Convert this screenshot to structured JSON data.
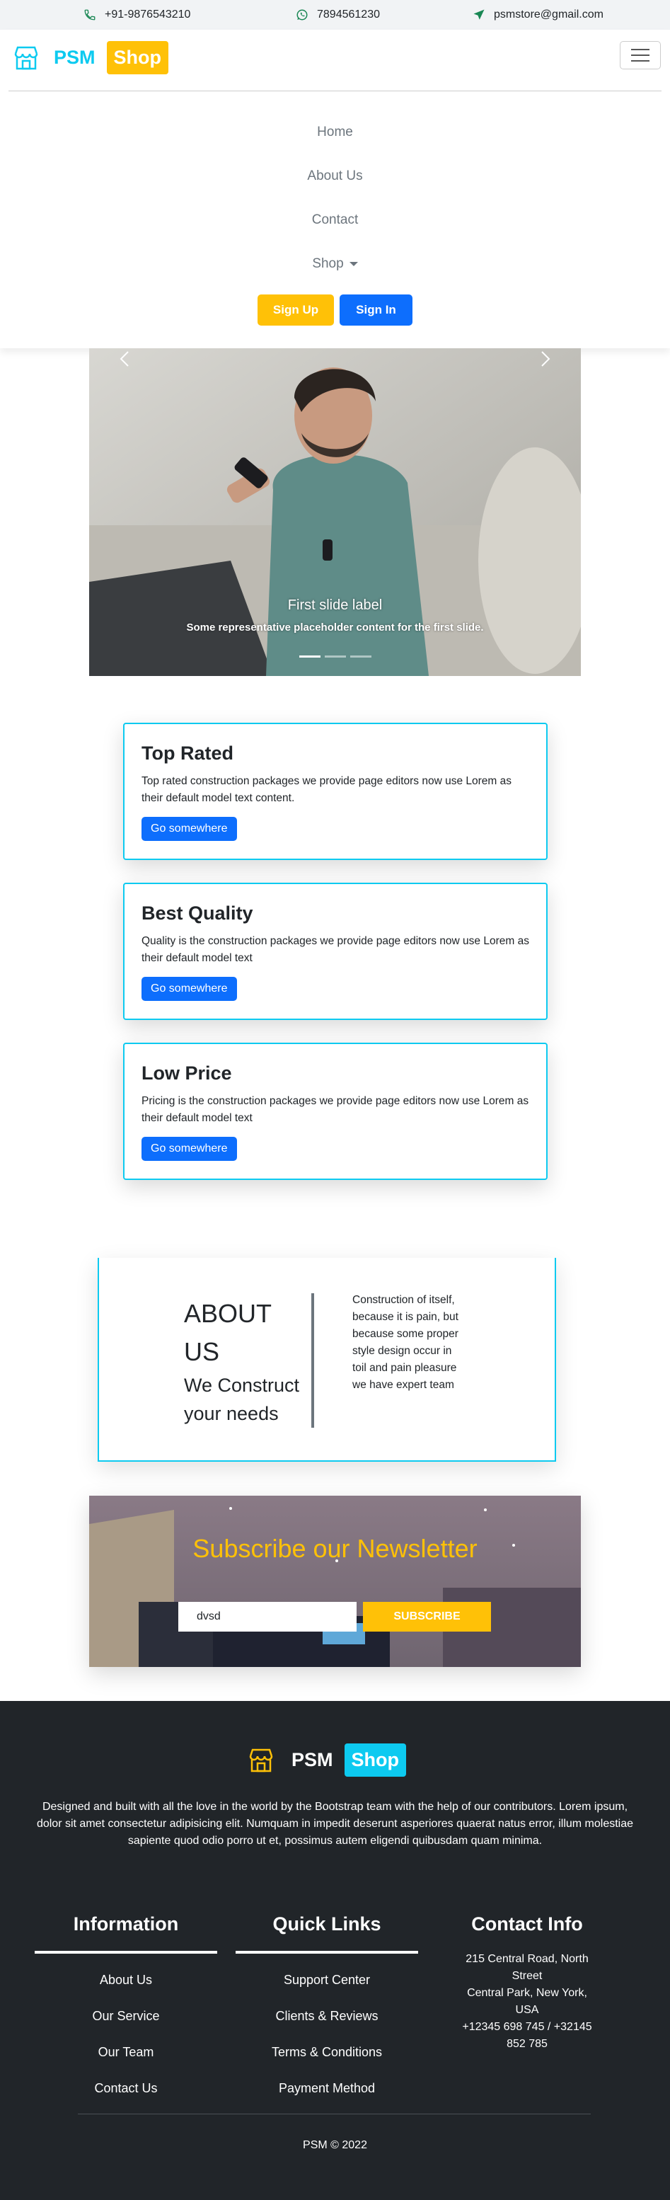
{
  "topbar": {
    "phone": "+91-9876543210",
    "whatsapp": "7894561230",
    "email": "psmstore@gmail.com"
  },
  "brand": {
    "psm": "PSM",
    "shop": "Shop"
  },
  "nav": {
    "links": [
      "Home",
      "About Us",
      "Contact",
      "Shop"
    ],
    "signup": "Sign Up",
    "signin": "Sign In"
  },
  "carousel": {
    "title": "First slide label",
    "text": "Some representative placeholder content for the first slide."
  },
  "cards": [
    {
      "title": "Top Rated",
      "text": "Top rated construction packages we provide page editors now use Lorem as their default model text content.",
      "button": "Go somewhere"
    },
    {
      "title": "Best Quality",
      "text": "Quality is the construction packages we provide page editors now use Lorem as their default model text",
      "button": "Go somewhere"
    },
    {
      "title": "Low Price",
      "text": "Pricing is the construction packages we provide page editors now use Lorem as their default model text",
      "button": "Go somewhere"
    }
  ],
  "about": {
    "heading": "ABOUT US",
    "sub": "We Construct your needs",
    "text": "Construction of itself, because it is pain, but because some proper style design occur in toil and pain pleasure we have expert team"
  },
  "newsletter": {
    "title": "Subscribe our Newsletter",
    "input_value": "dvsd",
    "button": "SUBSCRIBE"
  },
  "footer": {
    "brand": {
      "psm": "PSM",
      "shop": "Shop"
    },
    "description": "Designed and built with all the love in the world by the Bootstrap team with the help of our contributors. Lorem ipsum, dolor sit amet consectetur adipisicing elit. Numquam in impedit deserunt asperiores quaerat natus error, illum molestiae sapiente quod odio porro ut et, possimus autem eligendi quibusdam quam minima.",
    "information": {
      "title": "Information",
      "links": [
        "About Us",
        "Our Service",
        "Our Team",
        "Contact Us"
      ]
    },
    "quick_links": {
      "title": "Quick Links",
      "links": [
        "Support Center",
        "Clients & Reviews",
        "Terms & Conditions",
        "Payment Method"
      ]
    },
    "contact": {
      "title": "Contact Info",
      "address1": "215 Central Road, North Street",
      "address2": "Central Park, New York, USA",
      "phones": "+12345 698 745 / +32145 852 785"
    },
    "copyright": "PSM © 2022"
  },
  "colors": {
    "accent": "#0dcaf0",
    "warning": "#ffc107",
    "primary": "#0d6efd",
    "dark": "#212529"
  }
}
